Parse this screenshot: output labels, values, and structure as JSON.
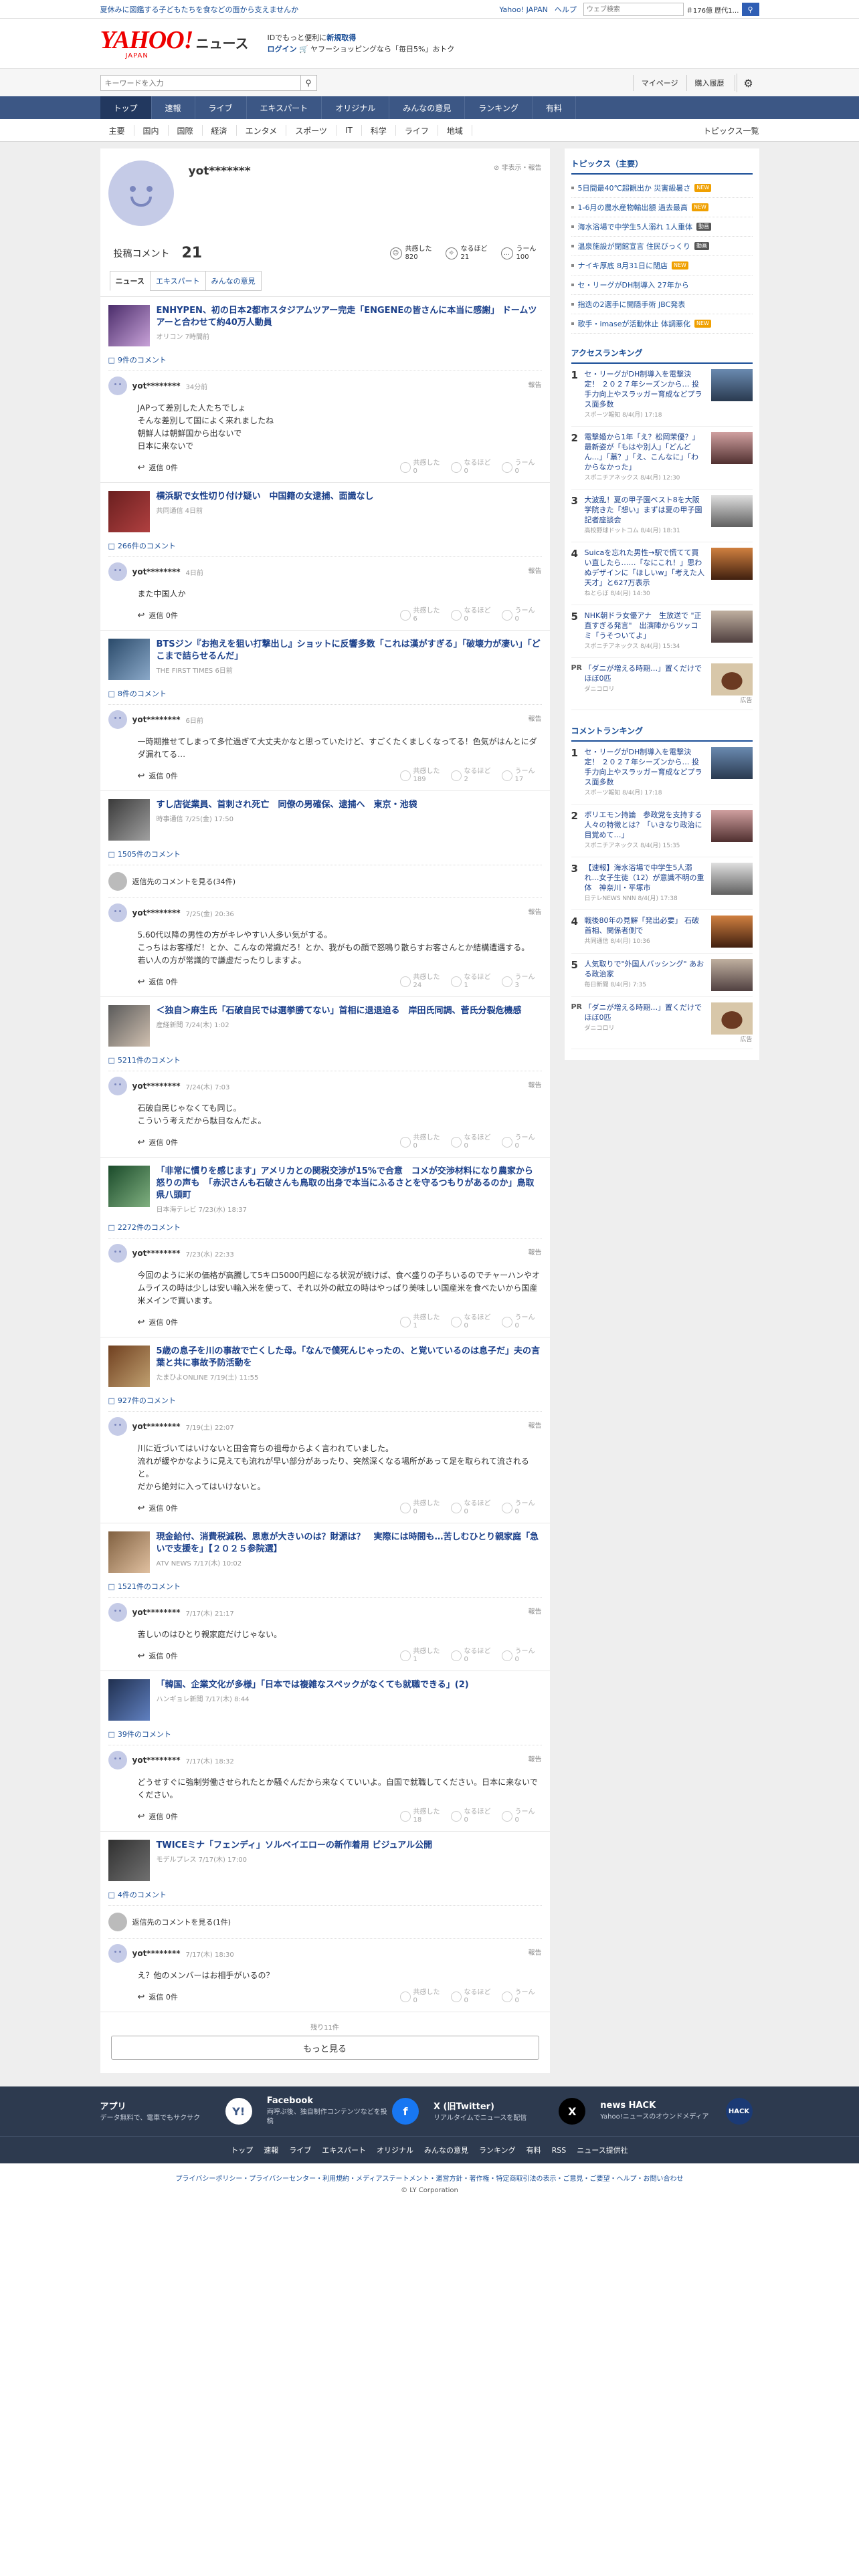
{
  "top": {
    "promo": "夏休みに図鑑する子どもたちを食などの面から支えませんか",
    "links": [
      "Yahoo! JAPAN",
      "ヘルプ"
    ],
    "search_placeholder": "ウェブ検索",
    "search_extra": "＃176億 歴代1…"
  },
  "header": {
    "logo": "YAHOO!",
    "logo_jp": "JAPAN",
    "logo_sub": "ニュース",
    "msg1": "IDでもっと便利に",
    "msg1_link": "新規取得",
    "msg2_login": "ログイン",
    "msg2_rest": "ヤフーショッピングなら「毎日5%」おトク"
  },
  "searchrow": {
    "placeholder": "キーワードを入力",
    "links": [
      "マイページ",
      "購入履歴"
    ]
  },
  "nav": [
    "トップ",
    "速報",
    "ライブ",
    "エキスパート",
    "オリジナル",
    "みんなの意見",
    "ランキング",
    "有料"
  ],
  "subnav": [
    "主要",
    "国内",
    "国際",
    "経済",
    "エンタメ",
    "スポーツ",
    "IT",
    "科学",
    "ライフ",
    "地域"
  ],
  "subnav_last": "トピックス一覧",
  "profile": {
    "name": "yot*******",
    "report": "非表示・報告",
    "comments_label": "投稿コメント",
    "comments_count": "21",
    "reacts": [
      {
        "icon": "smile",
        "label": "共感した",
        "value": "820"
      },
      {
        "icon": "lightbulb",
        "label": "なるほど",
        "value": "21"
      },
      {
        "icon": "thinking",
        "label": "うーん",
        "value": "100"
      }
    ],
    "tabs": [
      "ニュース",
      "エキスパート",
      "みんなの意見"
    ]
  },
  "react_labels": [
    "共感した",
    "なるほど",
    "うーん"
  ],
  "reply_label": "返信 0件",
  "report_label": "報告",
  "blocks": [
    {
      "title": "ENHYPEN、初の日本2都市スタジアムツアー完走「ENGENEの皆さんに本当に感謝」 ドームツアーと合わせて約40万人動員",
      "src": "オリコン 7時間前",
      "count": "9件のコメント",
      "comment": {
        "user": "yot********",
        "date": "34分前",
        "text": "JAPって差別した人たちでしょ\nそんな差別して国によく来れましたね\n朝鮮人は朝鮮国から出ないで\n日本に来ないで",
        "r": [
          "0",
          "0",
          "0"
        ]
      }
    },
    {
      "title": "横浜駅で女性切り付け疑い　中国籍の女逮捕、面識なし",
      "src": "共同通信 4日前",
      "count": "266件のコメント",
      "comment": {
        "user": "yot********",
        "date": "4日前",
        "text": "また中国人か",
        "r": [
          "6",
          "0",
          "0"
        ]
      }
    },
    {
      "title": "BTSジン『お抱えを狙い打撃出し』ショットに反響多数「これは漢がすぎる」「破壊力が凄い」「どこまで詰らせるんだ」",
      "src": "THE FIRST TIMES 6日前",
      "count": "8件のコメント",
      "comment": {
        "user": "yot********",
        "date": "6日前",
        "text": "一時期推せてしまって多忙過ぎて大丈夫かなと思っていたけど、すごくたくましくなってる！色気がはんとにダダ漏れてる…",
        "r": [
          "189",
          "2",
          "17"
        ]
      }
    },
    {
      "title": "すし店従業員、首刺され死亡　同僚の男確保、逮捕へ　東京・池袋",
      "src": "時事通信 7/25(金) 17:50",
      "count": "1505件のコメント",
      "showreplies": "返信先のコメントを見る(34件)",
      "comment": {
        "user": "yot********",
        "date": "7/25(金) 20:36",
        "text": "5.60代以降の男性の方がキレやすい人多い気がする。\nこっちはお客様だ！とか、こんなの常識だろ！とか、我がもの顔で怒鳴り散らすお客さんとか結構遭遇する。\n若い人の方が常識的で謙虚だったりしますよ。",
        "r": [
          "24",
          "1",
          "3"
        ]
      }
    },
    {
      "title": "＜独自＞麻生氏「石破自民では選挙勝てない」首相に退退迫る　岸田氏同調、菅氏分裂危機感",
      "src": "産経新聞 7/24(木) 1:02",
      "count": "5211件のコメント",
      "comment": {
        "user": "yot********",
        "date": "7/24(木) 7:03",
        "text": "石破自民じゃなくても同じ。\nこういう考えだから駄目なんだよ。",
        "r": [
          "0",
          "0",
          "0"
        ]
      }
    },
    {
      "title": "「非常に慣りを感じます」アメリカとの関税交渉が15%で合意　コメが交渉材料になり農家から怒りの声も　「赤沢さんも石破さんも鳥取の出身で本当にふるさとを守るつもりがあるのか」鳥取県八頭町",
      "src": "日本海テレビ 7/23(水) 18:37",
      "count": "2272件のコメント",
      "comment": {
        "user": "yot********",
        "date": "7/23(水) 22:33",
        "text": "今回のように米の価格が高騰して5キロ5000円超になる状況が続けば、食べ盛りの子ちいるのでチャーハンやオムライスの時は少しは安い輸入米を使って、それ以外の献立の時はやっぱり美味しい国産米を食べたいから国産米メインで買います。",
        "r": [
          "1",
          "0",
          "0"
        ]
      }
    },
    {
      "title": "5歳の息子を川の事故で亡くした母。「なんで僕死んじゃったの、と覚いているのは息子だ」夫の言葉と共に事故予防活動を",
      "src": "たまひよONLINE 7/19(土) 11:55",
      "count": "927件のコメント",
      "comment": {
        "user": "yot********",
        "date": "7/19(土) 22:07",
        "text": "川に近づいてはいけないと田舎育ちの祖母からよく言われていました。\n流れが緩やかなように見えても流れが早い部分があったり、突然深くなる場所があって足を取られて流されると。\nだから絶対に入ってはいけないと。",
        "r": [
          "0",
          "0",
          "0"
        ]
      }
    },
    {
      "title": "現金給付、消費税減税、思恵が大きいのは？財源は？　実際には時間も…苦しむひとり親家庭「急いで支援を」【２０２５参院選】",
      "src": "ATV NEWS 7/17(木) 10:02",
      "count": "1521件のコメント",
      "comment": {
        "user": "yot********",
        "date": "7/17(木) 21:17",
        "text": "苦しいのはひとり親家庭だけじゃない。",
        "r": [
          "1",
          "0",
          "0"
        ]
      }
    },
    {
      "title": "「韓国、企業文化が多様」「日本では複雑なスペックがなくても就職できる」(2)",
      "src": "ハンギョレ新聞 7/17(木) 8:44",
      "count": "39件のコメント",
      "comment": {
        "user": "yot********",
        "date": "7/17(木) 18:32",
        "text": "どうせすぐに強制労働させられたとか騒ぐんだから来なくていいよ。自国で就職してください。日本に来ないでください。",
        "r": [
          "18",
          "0",
          "0"
        ]
      }
    },
    {
      "title": "TWICEミナ「フェンディ」ソルベイエローの新作着用 ビジュアル公開",
      "src": "モデルプレス 7/17(木) 17:00",
      "count": "4件のコメント",
      "showreplies": "返信先のコメントを見る(1件)",
      "comment": {
        "user": "yot********",
        "date": "7/17(木) 18:30",
        "text": "え？他のメンバーはお相手がいるの？",
        "r": [
          "0",
          "0",
          "0"
        ]
      }
    }
  ],
  "remain": "残り11件",
  "more": "もっと見る",
  "right": {
    "topics_head": "トピックス（主要）",
    "topics": [
      {
        "text": "5日間最40℃超観出か 災害級暑さ",
        "badge": "NEW",
        "color": "#f0a000"
      },
      {
        "text": "1-6月の農水産物輸出額 過去最高",
        "badge": "NEW",
        "color": "#f0a000"
      },
      {
        "text": "海水浴場で中学生5人溺れ 1人重体",
        "badge": "動画",
        "color": "#555"
      },
      {
        "text": "温泉施設が閉館宣言 住民びっくり",
        "badge": "動画",
        "color": "#555"
      },
      {
        "text": "ナイキ厚底 8月31日に閉店",
        "badge": "NEW",
        "color": "#f0a000"
      },
      {
        "text": "セ・リーグがDH制導入 27年から",
        "badge": "",
        "color": ""
      },
      {
        "text": "指迭の2選手に開隠手術 JBC発表",
        "badge": "",
        "color": ""
      },
      {
        "text": "歌手・imaseが活動休止 体調悪化",
        "badge": "NEW",
        "color": "#f0a000"
      }
    ],
    "access_head": "アクセスランキング",
    "access": [
      {
        "n": "1",
        "t": "セ・リーグがDH制導入を電撃決定！ ２０２７年シーズンから… 投手力向上やスラッガー育成などプラス面多数",
        "s": "スポーツ報知 8/4(月) 17:18"
      },
      {
        "n": "2",
        "t": "電撃婚から1年「え？松岡茉優？」最新姿が「もはや別人」「どんどん…」「藁？」「え、こんなに」「わからなかった」",
        "s": "スポニチアネックス 8/4(月) 12:30"
      },
      {
        "n": "3",
        "t": "大波乱！夏の甲子園ベスト8を大阪学院きた「想い」まずは夏の甲子園記者座談会",
        "s": "高校野球ドットコム 8/4(月) 18:31"
      },
      {
        "n": "4",
        "t": "Suicaを忘れた男性→駅で慌てて買い直したら……「なにこれ！」思わぬデザインに「ほしいw」「考えた人天才」と627万表示",
        "s": "ねとらぼ 8/4(月) 14:30"
      },
      {
        "n": "5",
        "t": "NHK朝ドラ女優アナ　生放送で \"正直すぎる発言\"　出演陣からツッコミ「うそついてよ」",
        "s": "スポニチアネックス 8/4(月) 15:34"
      }
    ],
    "pr1": {
      "t": "「ダニが増える時期…」置くだけでほぼ0匹",
      "s": "ダニコロリ"
    },
    "comment_head": "コメントランキング",
    "crank": [
      {
        "n": "1",
        "t": "セ・リーグがDH制導入を電撃決定！ ２０２７年シーズンから… 投手力向上やスラッガー育成などプラス面多数",
        "s": "スポーツ報知 8/4(月) 17:18"
      },
      {
        "n": "2",
        "t": "ボリエモン持論　参政党を支持する人々の特徴とは？「いきなり政治に目覚めて…」",
        "s": "スポニチアネックス 8/4(月) 15:35"
      },
      {
        "n": "3",
        "t": "【速報】海水浴場で中学生5人溺れ…女子生徒（12）が意識不明の重体　神奈川・平塚市",
        "s": "日テレNEWS NNN 8/4(月) 17:38"
      },
      {
        "n": "4",
        "t": "戦後80年の見解「発出必要」 石破首相、関係者側で",
        "s": "共同通信 8/4(月) 10:36"
      },
      {
        "n": "5",
        "t": "人気取りで\"外国人バッシング\" あおる政治家",
        "s": "毎日新聞 8/4(月) 7:35"
      }
    ],
    "pr2": {
      "t": "「ダニが増える時期…」置くだけでほぼ0匹",
      "s": "ダニコロリ"
    },
    "pr_label": "PR",
    "ad_label": "広告"
  },
  "footer": {
    "items": [
      {
        "h": "アプリ",
        "d": "データ無料で、電車でもサクサク",
        "icon": "Y!",
        "bg": "#fff",
        "fg": "#3c5785"
      },
      {
        "h": "Facebook",
        "d": "両呼ぶ後、独自制作コンテンツなどを投稿",
        "icon": "f",
        "bg": "#1877f2",
        "fg": "#fff"
      },
      {
        "h": "X (旧Twitter)",
        "d": "リアルタイムでニュースを配信",
        "icon": "X",
        "bg": "#000",
        "fg": "#fff"
      },
      {
        "h": "news HACK",
        "d": "Yahoo!ニュースのオウンドメディア",
        "icon": "HACK",
        "bg": "#1b3a75",
        "fg": "#fff"
      }
    ],
    "links": [
      "トップ",
      "速報",
      "ライブ",
      "エキスパート",
      "オリジナル",
      "みんなの意見",
      "ランキング",
      "有料",
      "RSS",
      "ニュース提供社"
    ],
    "legal": "プライバシーポリシー・プライバシーセンター・利用規約・メディアステートメント・運営方針・著作権・特定商取引法の表示・ご意見・ご要望・ヘルプ・お問い合わせ",
    "copy": "© LY Corporation"
  }
}
